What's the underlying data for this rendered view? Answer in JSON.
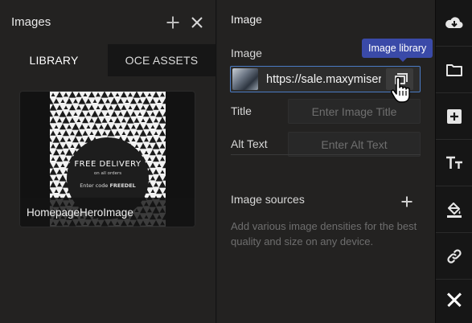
{
  "images_panel": {
    "title": "Images",
    "tabs": [
      {
        "label": "LIBRARY",
        "active": true
      },
      {
        "label": "OCE ASSETS",
        "active": false
      }
    ],
    "items": [
      {
        "name": "HomepageHeroImage",
        "promo": {
          "line1": "FREE DELIVERY",
          "line2": "on all orders",
          "line3_prefix": "Enter code ",
          "line3_code": "FREEDEL"
        }
      }
    ]
  },
  "image_settings": {
    "title": "Image",
    "image_label": "Image",
    "image_url": "https://sale.maxymiser.com",
    "library_tooltip": "Image library",
    "title_label": "Title",
    "title_placeholder": "Enter Image Title",
    "alt_label": "Alt Text",
    "alt_placeholder": "Enter Alt Text",
    "sources_title": "Image sources",
    "sources_description": "Add various image densities for the best quality and size on any device."
  },
  "rail": {
    "icons": [
      "download-cloud-icon",
      "folder-icon",
      "add-box-icon",
      "text-size-icon",
      "paint-bucket-icon",
      "link-icon",
      "close-icon"
    ]
  }
}
